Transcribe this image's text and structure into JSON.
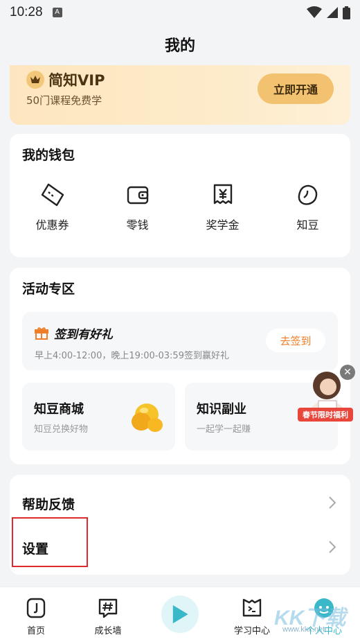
{
  "status_bar": {
    "time": "10:28",
    "notification_icon": "A",
    "icons": [
      "wifi-icon",
      "signal-icon",
      "battery-icon"
    ]
  },
  "header": {
    "title": "我的"
  },
  "vip": {
    "title": "简知VIP",
    "subtitle": "50门课程免费学",
    "button": "立即开通",
    "icon": "crown-icon"
  },
  "wallet": {
    "title": "我的钱包",
    "items": [
      {
        "label": "优惠券",
        "icon": "coupon-icon"
      },
      {
        "label": "零钱",
        "icon": "wallet-icon"
      },
      {
        "label": "奖学金",
        "icon": "scholarship-icon"
      },
      {
        "label": "知豆",
        "icon": "bean-icon"
      }
    ]
  },
  "activity": {
    "title": "活动专区",
    "signin": {
      "title": "签到有好礼",
      "subtitle": "早上4:00-12:00，晚上19:00-03:59签到赢好礼",
      "button": "去签到"
    },
    "tiles": [
      {
        "title": "知豆商城",
        "subtitle": "知豆兑换好物"
      },
      {
        "title": "知识副业",
        "subtitle": "一起学一起赚"
      }
    ],
    "float_badge": {
      "label": "春节限时福利"
    }
  },
  "help": {
    "rows": [
      {
        "label": "帮助反馈"
      },
      {
        "label": "设置"
      }
    ]
  },
  "tab_bar": {
    "tabs": [
      {
        "label": "首页",
        "icon": "home-icon"
      },
      {
        "label": "成长墙",
        "icon": "hashtag-icon"
      },
      {
        "label": "",
        "icon": "play-icon"
      },
      {
        "label": "学习中心",
        "icon": "study-center-icon"
      },
      {
        "label": "个人中心",
        "icon": "profile-icon"
      }
    ]
  },
  "watermark": {
    "text": "KK下载",
    "url": "www.kkx.net"
  },
  "colors": {
    "accent": "#3ab7c9",
    "vip_bg": "#fde6bf",
    "vip_button": "#f3c271",
    "signin_button_text": "#f07d27",
    "highlight": "#e02a2a"
  }
}
